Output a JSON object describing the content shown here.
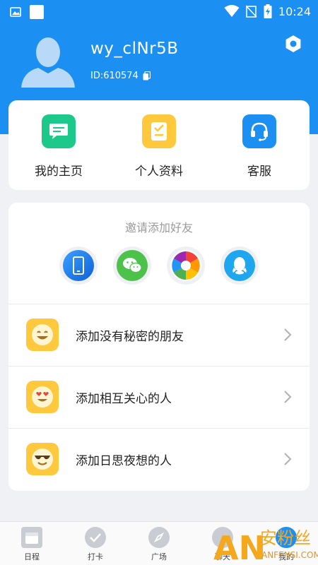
{
  "status_bar": {
    "time": "10:24"
  },
  "profile": {
    "username": "wy_clNr5B",
    "user_id": "ID:610574"
  },
  "quick_actions": [
    {
      "label": "我的主页",
      "icon": "chat-bubble-icon",
      "color": "#1dc98a"
    },
    {
      "label": "个人资料",
      "icon": "profile-doc-icon",
      "color": "#ffc83d"
    },
    {
      "label": "客服",
      "icon": "headset-icon",
      "color": "#1b8ff2"
    }
  ],
  "invite": {
    "title": "邀请添加好友",
    "channels": [
      {
        "icon": "phone-contacts-icon"
      },
      {
        "icon": "wechat-icon"
      },
      {
        "icon": "moments-icon"
      },
      {
        "icon": "qq-icon"
      }
    ]
  },
  "friend_rows": [
    {
      "label": "添加没有秘密的朋友",
      "icon": "smile-emoji-icon"
    },
    {
      "label": "添加相互关心的人",
      "icon": "heart-eyes-emoji-icon"
    },
    {
      "label": "添加日思夜想的人",
      "icon": "sunglasses-emoji-icon"
    }
  ],
  "tabs": [
    {
      "label": "日程",
      "icon": "calendar-icon"
    },
    {
      "label": "打卡",
      "icon": "check-icon"
    },
    {
      "label": "广场",
      "icon": "compass-icon"
    },
    {
      "label": "聊天",
      "icon": "chat-icon"
    },
    {
      "label": "我的",
      "icon": "user-icon"
    }
  ],
  "watermark": {
    "brand": "安粉丝",
    "url": "ANFENSI.COM",
    "logo_text": "AN"
  },
  "colors": {
    "primary": "#1b8ff2",
    "yellow": "#ffc83d",
    "green": "#1dc98a"
  }
}
